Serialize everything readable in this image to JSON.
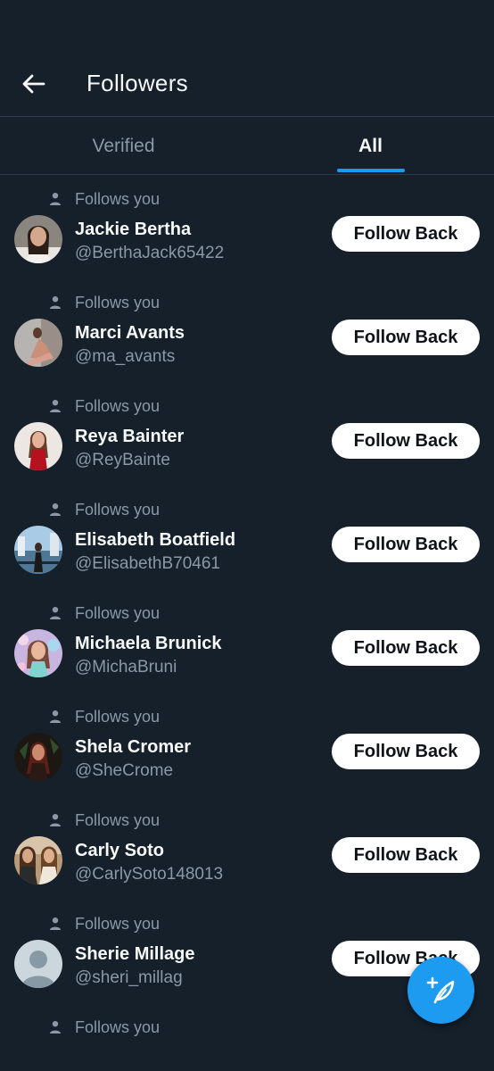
{
  "header": {
    "title": "Followers",
    "back_icon": "arrow-left-icon"
  },
  "tabs": [
    {
      "label": "Verified",
      "active": false
    },
    {
      "label": "All",
      "active": true
    }
  ],
  "colors": {
    "background": "#15202b",
    "accent": "#1d9bf0",
    "secondary_text": "#8b98a5",
    "button_bg": "#ffffff",
    "divider": "#2f3b47"
  },
  "followers": [
    {
      "follows_label": "Follows you",
      "name": "Jackie Bertha",
      "handle": "@BerthaJack65422",
      "button": "Follow Back"
    },
    {
      "follows_label": "Follows you",
      "name": "Marci Avants",
      "handle": "@ma_avants",
      "button": "Follow Back"
    },
    {
      "follows_label": "Follows you",
      "name": "Reya Bainter",
      "handle": "@ReyBainte",
      "button": "Follow Back"
    },
    {
      "follows_label": "Follows you",
      "name": "Elisabeth Boatfield",
      "handle": "@ElisabethB70461",
      "button": "Follow Back"
    },
    {
      "follows_label": "Follows you",
      "name": "Michaela Brunick",
      "handle": "@MichaBruni",
      "button": "Follow Back"
    },
    {
      "follows_label": "Follows you",
      "name": "Shela Cromer",
      "handle": "@SheCrome",
      "button": "Follow Back"
    },
    {
      "follows_label": "Follows you",
      "name": "Carly Soto",
      "handle": "@CarlySoto148013",
      "button": "Follow Back"
    },
    {
      "follows_label": "Follows you",
      "name": "Sherie Millage",
      "handle": "@sheri_millag",
      "button": "Follow Back"
    },
    {
      "follows_label": "Follows you"
    }
  ],
  "fab": {
    "icon": "compose-post-icon"
  }
}
